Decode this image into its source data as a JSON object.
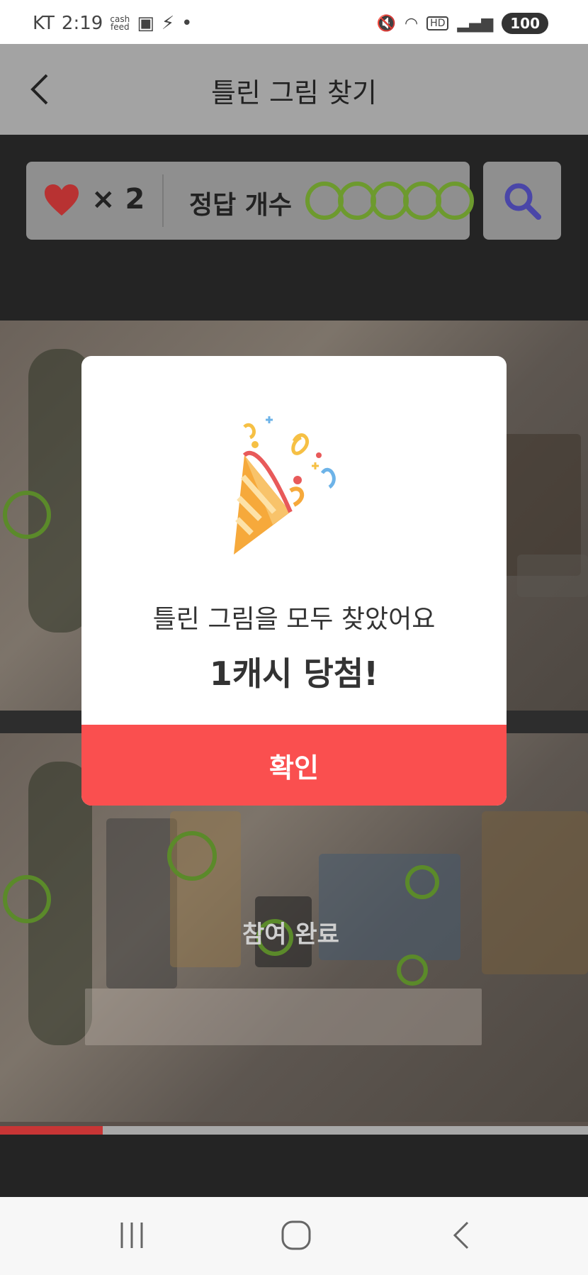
{
  "status_bar": {
    "carrier": "KT",
    "time": "2:19",
    "cashfeed": "cash feed",
    "battery": "100"
  },
  "header": {
    "title": "틀린 그림 찾기"
  },
  "score": {
    "lives": "× 2",
    "answer_label": "정답 개수",
    "answers_found": 5,
    "answers_total": 5
  },
  "game": {
    "participated_text": "참여 완료",
    "progress": 0.175
  },
  "modal": {
    "message": "틀린 그림을 모두 찾았어요",
    "prize": "1캐시 당첨!",
    "confirm_label": "확인"
  },
  "colors": {
    "accent": "#fa4f4f",
    "found_circle": "#6d9a2e",
    "heart": "#d93a3a",
    "hint_icon": "#5a55c8"
  }
}
